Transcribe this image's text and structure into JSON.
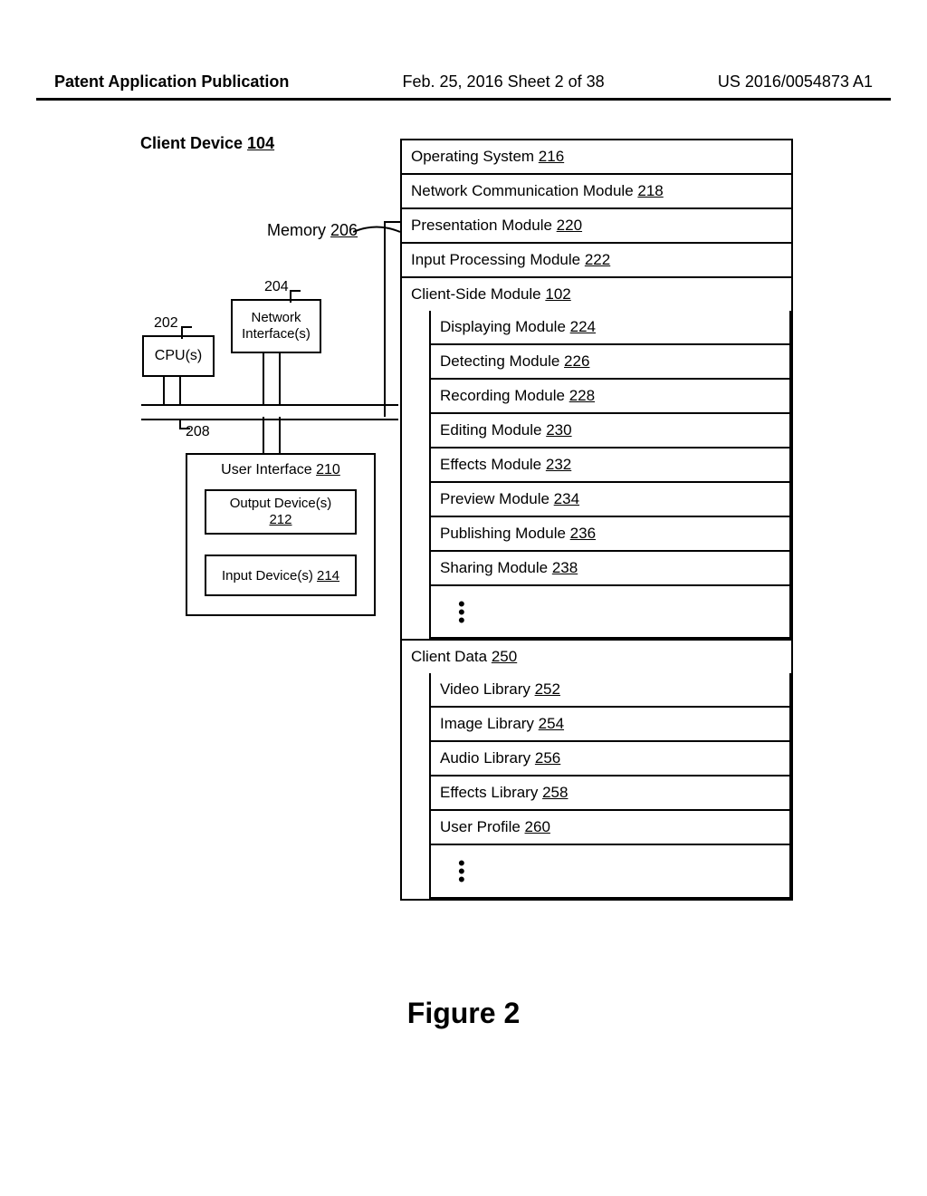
{
  "header": {
    "left": "Patent Application Publication",
    "middle": "Feb. 25, 2016  Sheet 2 of 38",
    "right": "US 2016/0054873 A1"
  },
  "client_device": {
    "label_prefix": "Client Device ",
    "label_num": "104"
  },
  "memory": {
    "label_prefix": "Memory ",
    "label_num": "206"
  },
  "refs": {
    "cpu_ref": "202",
    "net_ref": "204",
    "bus_ref": "208"
  },
  "hardware": {
    "cpu": "CPU(s)",
    "net": "Network Interface(s)",
    "ui_prefix": "User Interface ",
    "ui_num": "210",
    "out_prefix": "Output Device(s)",
    "out_num": "212",
    "in_prefix": "Input Device(s) ",
    "in_num": "214"
  },
  "mem_rows": {
    "os": {
      "t": "Operating System ",
      "n": "216"
    },
    "netcomm": {
      "t": "Network Communication Module ",
      "n": "218"
    },
    "presentation": {
      "t": "Presentation Module ",
      "n": "220"
    },
    "inputproc": {
      "t": "Input Processing Module ",
      "n": "222"
    },
    "clientside": {
      "t": "Client-Side Module ",
      "n": "102"
    },
    "display_m": {
      "t": "Displaying Module ",
      "n": "224"
    },
    "detect_m": {
      "t": "Detecting Module ",
      "n": "226"
    },
    "record_m": {
      "t": "Recording Module ",
      "n": "228"
    },
    "edit_m": {
      "t": "Editing Module ",
      "n": "230"
    },
    "effects_m": {
      "t": "Effects Module ",
      "n": "232"
    },
    "preview_m": {
      "t": "Preview Module ",
      "n": "234"
    },
    "publish_m": {
      "t": "Publishing Module ",
      "n": "236"
    },
    "share_m": {
      "t": "Sharing Module ",
      "n": "238"
    },
    "clientdata": {
      "t": "Client Data ",
      "n": "250"
    },
    "video_lib": {
      "t": "Video Library ",
      "n": "252"
    },
    "image_lib": {
      "t": "Image Library ",
      "n": "254"
    },
    "audio_lib": {
      "t": "Audio Library ",
      "n": "256"
    },
    "effects_lib": {
      "t": "Effects Library ",
      "n": "258"
    },
    "user_prof": {
      "t": "User Profile ",
      "n": "260"
    }
  },
  "figure_caption": "Figure 2"
}
